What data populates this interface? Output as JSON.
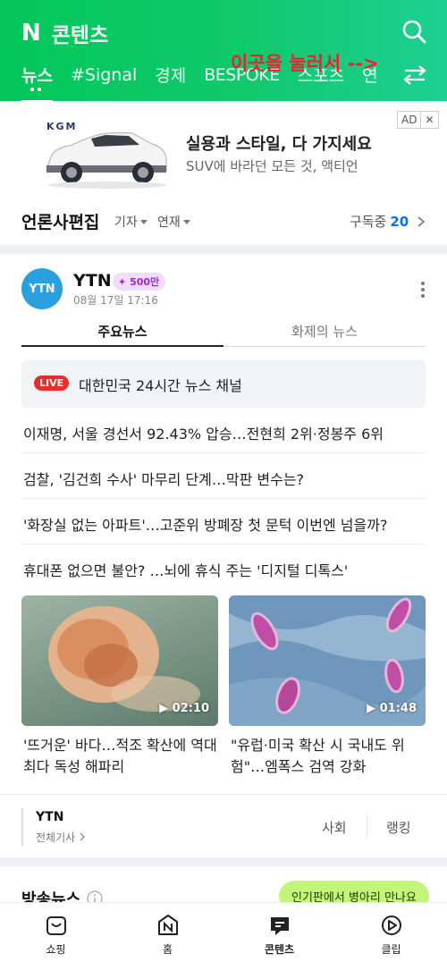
{
  "header": {
    "logo": "N",
    "title": "콘텐츠",
    "tabs": [
      "뉴스",
      "#Signal",
      "경제",
      "BESPOKE",
      "스포츠",
      "연"
    ],
    "overlay_note": "이곳을 눌러서 -->"
  },
  "ad": {
    "brand": "KGM",
    "title": "실용과 스타일, 다 가지세요",
    "subtitle": "SUV에 바라던 모든 것, 액티언",
    "badge": "AD",
    "close": "✕"
  },
  "press": {
    "title": "언론사편집",
    "filter_reporter": "기자",
    "filter_series": "연재",
    "subscribe_label": "구독중",
    "subscribe_count": "20"
  },
  "card": {
    "logo": "YTN",
    "name": "YTN",
    "badge": "500만",
    "time": "08월 17일 17:16",
    "subtabs": [
      "주요뉴스",
      "화제의 뉴스"
    ],
    "live_badge": "LIVE",
    "live_text": "대한민국 24시간 뉴스 채널",
    "headlines": [
      "이재명, 서울 경선서 92.43% 압승…전현희 2위·정봉주 6위",
      "검찰, '김건희 수사' 마무리 단계…막판 변수는?",
      "'화장실 없는 아파트'…고준위 방폐장 첫 문턱 이번엔 넘을까?",
      "휴대폰 없으면 불안? …뇌에 휴식 주는 '디지털 디톡스'"
    ],
    "videos": [
      {
        "duration": "02:10",
        "caption": "'뜨거운' 바다…적조 확산에 역대 최다 독성 해파리"
      },
      {
        "duration": "01:48",
        "caption": "\"유럽·미국 확산 시 국내도 위험\"…엠폭스 검역 강화"
      }
    ],
    "footer": {
      "name": "YTN",
      "all_articles": "전체기사",
      "links": [
        "사회",
        "랭킹"
      ]
    }
  },
  "broadcast": {
    "title": "방송뉴스",
    "toast": "인기판에서 병아리 만나요"
  },
  "bottom_nav": [
    {
      "label": "쇼핑",
      "icon": "shopping-bag-icon"
    },
    {
      "label": "홈",
      "icon": "home-n-icon"
    },
    {
      "label": "콘텐츠",
      "icon": "contents-icon"
    },
    {
      "label": "클립",
      "icon": "clip-icon"
    }
  ],
  "colors": {
    "brand_green": "#03c75a",
    "overlay_red": "#e8232d",
    "live_red": "#e82d2d",
    "link_blue": "#0c70f2",
    "toast_green": "#c4f47a"
  }
}
